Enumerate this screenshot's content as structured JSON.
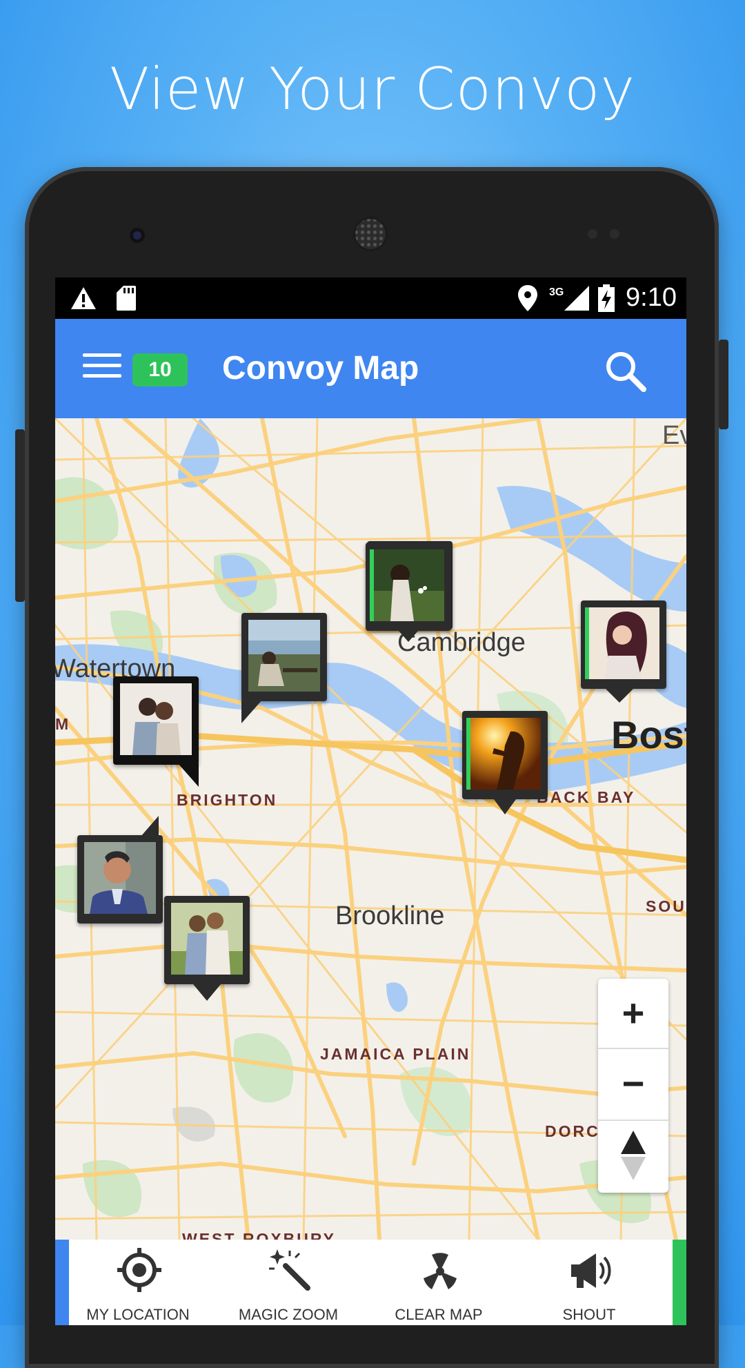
{
  "headline": "View Your Convoy",
  "status_bar": {
    "time": "9:10",
    "network": "3G",
    "icons": [
      "warning-icon",
      "sd-card-icon",
      "location-pin-icon",
      "signal-icon",
      "battery-charging-icon"
    ]
  },
  "app_bar": {
    "title": "Convoy Map",
    "badge_count": "10",
    "menu_icon": "hamburger-menu-icon",
    "search_icon": "search-icon"
  },
  "map": {
    "places": {
      "cambridge": "Cambridge",
      "watertown": "Watertown",
      "brighton": "BRIGHTON",
      "back_bay": "BACK BAY",
      "boston": "Bost",
      "brookline": "Brookline",
      "jamaica_plain": "JAMAICA PLAIN",
      "dorchester": "DORC      R",
      "south": "SOU",
      "west_roxbury": "WEST ROXBURY",
      "edge_m": "M",
      "everett": "Ev"
    },
    "zoom_controls": {
      "zoom_in": "+",
      "zoom_out": "−",
      "compass": "compass-icon"
    }
  },
  "bottom_nav": [
    {
      "label": "MY LOCATION",
      "icon": "crosshair-icon"
    },
    {
      "label": "MAGIC ZOOM",
      "icon": "magic-wand-icon"
    },
    {
      "label": "CLEAR MAP",
      "icon": "radiation-icon"
    },
    {
      "label": "SHOUT",
      "icon": "megaphone-icon"
    }
  ],
  "colors": {
    "app_bar": "#3f86f0",
    "badge": "#2ec35a",
    "online_stripe": "#32d05a",
    "map_road": "#fbd17f",
    "map_water": "#a8cbf5"
  }
}
